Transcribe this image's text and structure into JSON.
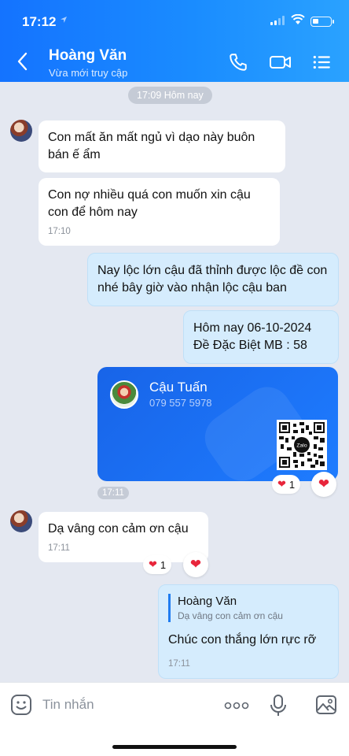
{
  "status_bar": {
    "time": "17:12"
  },
  "header": {
    "name": "Hoàng Văn",
    "subtitle": "Vừa mới truy cập"
  },
  "chat": {
    "date_separator": "17:09 Hôm nay",
    "messages": [
      {
        "text": "Con mất ăn mất ngủ vì dạo này buôn bán ế ẩm"
      },
      {
        "text": "Con nợ nhiều quá con muốn xin cậu con để hôm nay",
        "time": "17:10"
      },
      {
        "text": "Nay lộc lớn cậu đã thỉnh được lộc đề con nhé bây giờ vào nhận lộc cậu ban"
      },
      {
        "text_line1": "Hôm nay 06-10-2024",
        "text_line2": "Đề Đặc Biệt MB : 58"
      },
      {
        "text": "Dạ vâng con cảm ơn cậu",
        "time": "17:11",
        "reaction_count": "1"
      }
    ],
    "contact_card": {
      "name": "Cậu Tuấn",
      "phone": "079 557 5978",
      "time": "17:11",
      "reaction_count": "1",
      "qr_badge": "Zalo"
    },
    "reply": {
      "quoted_name": "Hoàng Văn",
      "quoted_text": "Dạ vâng con cảm ơn cậu",
      "text": "Chúc con thắng lớn rực rỡ",
      "time": "17:11"
    }
  },
  "input": {
    "placeholder": "Tin nhắn"
  },
  "colors": {
    "header_blue": "#1a8cff",
    "outgoing_bubble": "#d5ecfd",
    "heart": "#e8253b",
    "background": "#e4e8f1"
  }
}
